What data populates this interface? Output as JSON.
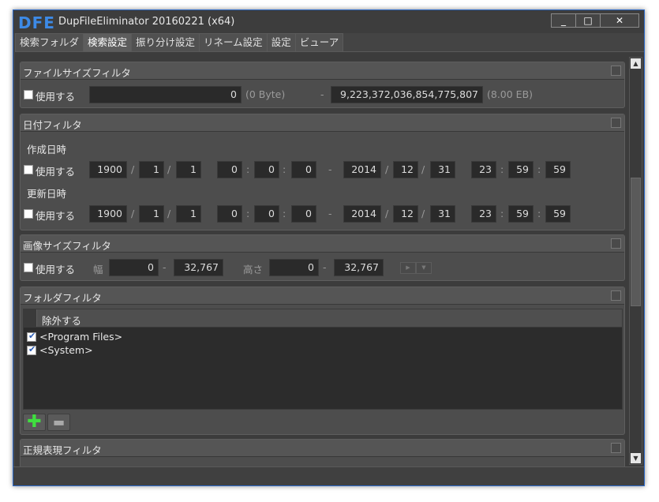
{
  "window": {
    "logo": "DFE",
    "title": "DupFileEliminator 20160221 (x64)",
    "min": "_",
    "max": "□",
    "close": "✕"
  },
  "tabs": [
    "検索フォルダ",
    "検索設定",
    "振り分け設定",
    "リネーム設定",
    "設定",
    "ビューア"
  ],
  "use_label": "使用する",
  "filesize": {
    "title": "ファイルサイズフィルタ",
    "min": "0",
    "min_unit": "(0 Byte)",
    "dash": "-",
    "max": "9,223,372,036,854,775,807",
    "max_unit": "(8.00 EB)"
  },
  "date": {
    "title": "日付フィルタ",
    "created_label": "作成日時",
    "modified_label": "更新日時",
    "slash": "/",
    "colon": ":",
    "dash": "-",
    "from": {
      "year": "1900",
      "month": "1",
      "day": "1",
      "hour": "0",
      "min": "0",
      "sec": "0"
    },
    "to": {
      "year": "2014",
      "month": "12",
      "day": "31",
      "hour": "23",
      "min": "59",
      "sec": "59"
    }
  },
  "image": {
    "title": "画像サイズフィルタ",
    "width_label": "幅",
    "height_label": "高さ",
    "w_min": "0",
    "w_max": "32,767",
    "h_min": "0",
    "h_max": "32,767",
    "dash": "-"
  },
  "folder": {
    "title": "フォルダフィルタ",
    "column": "除外する",
    "items": [
      "<Program Files>",
      "<System>"
    ],
    "add": "✚",
    "remove": "▬"
  },
  "regex": {
    "title": "正規表現フィルタ"
  }
}
